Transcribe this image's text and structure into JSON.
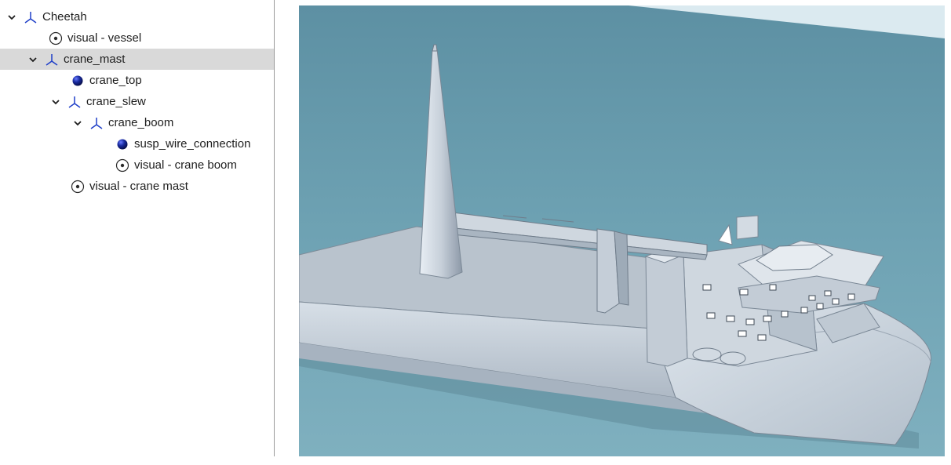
{
  "tree": {
    "items": [
      {
        "label": "Cheetah",
        "icon": "frame-axes-icon",
        "expanded": true,
        "selected": false
      },
      {
        "label": "visual - vessel",
        "icon": "visual-icon",
        "expanded": null,
        "selected": false
      },
      {
        "label": "crane_mast",
        "icon": "frame-axes-icon",
        "expanded": true,
        "selected": true
      },
      {
        "label": "crane_top",
        "icon": "point-icon",
        "expanded": null,
        "selected": false
      },
      {
        "label": "crane_slew",
        "icon": "frame-axes-icon",
        "expanded": true,
        "selected": false
      },
      {
        "label": "crane_boom",
        "icon": "frame-axes-icon",
        "expanded": true,
        "selected": false
      },
      {
        "label": "susp_wire_connection",
        "icon": "point-icon",
        "expanded": null,
        "selected": false
      },
      {
        "label": "visual - crane boom",
        "icon": "visual-icon",
        "expanded": null,
        "selected": false
      },
      {
        "label": "visual - crane mast",
        "icon": "visual-icon",
        "expanded": null,
        "selected": false
      }
    ]
  },
  "colors": {
    "selection": "#d9d9d9",
    "frame_icon": "#1f3fc8",
    "point_icon": "#0a1a7a",
    "sea": "#6a9dad",
    "sky": "#dbeaf0",
    "hull": "#c9d2dc"
  }
}
